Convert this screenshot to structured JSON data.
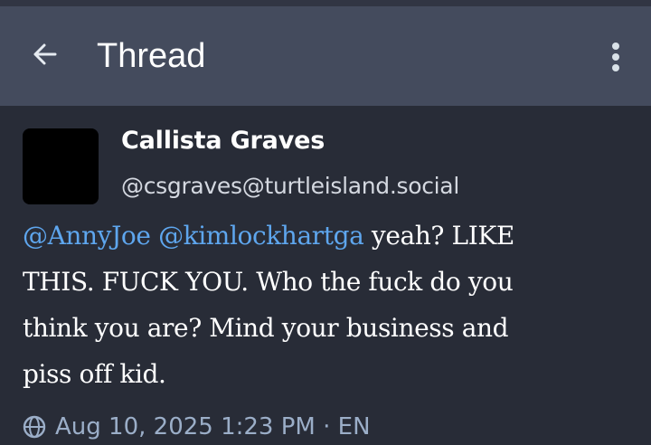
{
  "header": {
    "title": "Thread",
    "back_icon": "arrow-left-icon",
    "menu_icon": "more-vertical-icon"
  },
  "post": {
    "avatar_color": "#000000",
    "display_name": "Callista Graves",
    "handle": "@csgraves@turtleisland.social",
    "mention_1": "@AnnyJoe",
    "mention_2": "@kimlockhartga",
    "line_1_rest": " yeah?  LIKE",
    "line_2": "THIS.  FUCK YOU.  Who the fuck do you",
    "line_3": "think you are?  Mind your business and",
    "line_4": "piss off kid.",
    "meta_text": "Aug 10, 2025 1:23 PM · EN",
    "visibility_icon": "globe-icon"
  },
  "colors": {
    "app_bar": "#444b5d",
    "background": "#282c37",
    "mention": "#5ea6ee",
    "text": "#ffffff",
    "secondary_text": "#d4d8e0"
  }
}
